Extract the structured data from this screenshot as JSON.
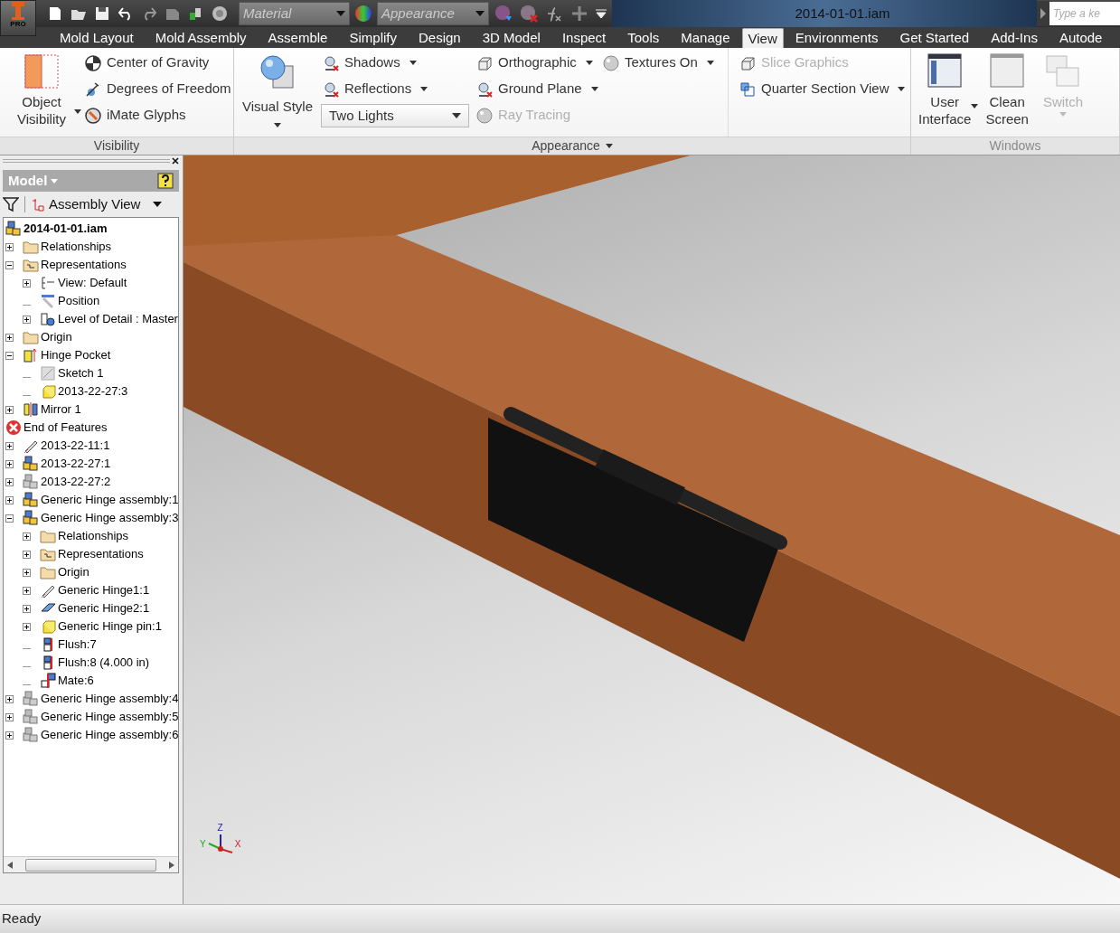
{
  "title_bar": {
    "app_badge": "PRO",
    "material": "Material",
    "appearance": "Appearance",
    "title": "2014-01-01.iam",
    "search_placeholder": "Type a ke"
  },
  "tabs": [
    {
      "label": "Mold Layout",
      "selected": false
    },
    {
      "label": "Mold Assembly",
      "selected": false
    },
    {
      "label": "Assemble",
      "selected": false
    },
    {
      "label": "Simplify",
      "selected": false
    },
    {
      "label": "Design",
      "selected": false
    },
    {
      "label": "3D Model",
      "selected": false
    },
    {
      "label": "Inspect",
      "selected": false
    },
    {
      "label": "Tools",
      "selected": false
    },
    {
      "label": "Manage",
      "selected": false
    },
    {
      "label": "View",
      "selected": true
    },
    {
      "label": "Environments",
      "selected": false
    },
    {
      "label": "Get Started",
      "selected": false
    },
    {
      "label": "Add-Ins",
      "selected": false
    },
    {
      "label": "Autode",
      "selected": false
    }
  ],
  "ribbon": {
    "visibility": {
      "label": "Visibility",
      "big": {
        "label": "Object Visibility",
        "dropdown": true
      },
      "items": [
        {
          "label": "Center of Gravity"
        },
        {
          "label": "Degrees of Freedom"
        },
        {
          "label": "iMate Glyphs"
        }
      ]
    },
    "appearance": {
      "label": "Appearance",
      "visual_style": "Visual Style",
      "columns": [
        [
          {
            "kind": "button",
            "label": "Shadows",
            "dropdown": true,
            "disabled": false
          },
          {
            "kind": "button",
            "label": "Reflections",
            "dropdown": true,
            "disabled": false
          },
          {
            "kind": "combo",
            "label": "Two Lights"
          }
        ],
        [
          {
            "kind": "button",
            "label": "Orthographic",
            "dropdown": true,
            "disabled": false
          },
          {
            "kind": "button",
            "label": "Ground Plane",
            "dropdown": true,
            "disabled": false
          },
          {
            "kind": "button",
            "label": "Ray Tracing",
            "dropdown": false,
            "disabled": true
          }
        ],
        [
          {
            "kind": "button",
            "label": "Textures On",
            "dropdown": true,
            "disabled": false
          }
        ],
        [
          {
            "kind": "button",
            "label": "Slice Graphics",
            "dropdown": false,
            "disabled": true
          },
          {
            "kind": "button",
            "label": "Quarter Section View",
            "dropdown": true,
            "disabled": false
          }
        ]
      ]
    },
    "windows": {
      "label": "Windows",
      "items": [
        {
          "label": "User Interface",
          "dropdown": true,
          "disabled": false
        },
        {
          "label": "Clean Screen",
          "dropdown": false,
          "disabled": false
        },
        {
          "label": "Switch",
          "dropdown": true,
          "disabled": true
        }
      ]
    }
  },
  "browser": {
    "title": "Model",
    "view": "Assembly View",
    "tree": {
      "label": "2014-01-01.iam",
      "kind": "assembly",
      "bold": true,
      "children": [
        {
          "label": "Relationships",
          "kind": "folder",
          "expanded": false
        },
        {
          "label": "Representations",
          "kind": "reps",
          "expanded": true,
          "children": [
            {
              "label": "View: Default",
              "kind": "view",
              "expanded": false
            },
            {
              "label": "Position",
              "kind": "position"
            },
            {
              "label": "Level of Detail : Master",
              "kind": "lod",
              "expanded": false
            }
          ]
        },
        {
          "label": "Origin",
          "kind": "folder",
          "expanded": false
        },
        {
          "label": "Hinge Pocket",
          "kind": "feature",
          "expanded": true,
          "children": [
            {
              "label": "Sketch 1",
              "kind": "sketch"
            },
            {
              "label": "2013-22-27:3",
              "kind": "part"
            }
          ]
        },
        {
          "label": "Mirror 1",
          "kind": "mirror",
          "expanded": false
        },
        {
          "label": "End of Features",
          "kind": "end"
        },
        {
          "label": "2013-22-11:1",
          "kind": "pin",
          "expanded": false
        },
        {
          "label": "2013-22-27:1",
          "kind": "assembly",
          "expanded": false
        },
        {
          "label": "2013-22-27:2",
          "kind": "assembly-grey",
          "expanded": false
        },
        {
          "label": "Generic Hinge assembly:1",
          "kind": "assembly",
          "expanded": false
        },
        {
          "label": "Generic Hinge assembly:3",
          "kind": "assembly",
          "expanded": true,
          "children": [
            {
              "label": "Relationships",
              "kind": "folder",
              "expanded": false
            },
            {
              "label": "Representations",
              "kind": "reps",
              "expanded": false
            },
            {
              "label": "Origin",
              "kind": "folder",
              "expanded": false
            },
            {
              "label": "Generic Hinge1:1",
              "kind": "pin",
              "expanded": false
            },
            {
              "label": "Generic Hinge2:1",
              "kind": "leaf",
              "expanded": false
            },
            {
              "label": "Generic Hinge pin:1",
              "kind": "part",
              "expanded": false
            },
            {
              "label": "Flush:7",
              "kind": "flush"
            },
            {
              "label": "Flush:8 (4.000 in)",
              "kind": "flush"
            },
            {
              "label": "Mate:6",
              "kind": "mate"
            }
          ]
        },
        {
          "label": "Generic Hinge assembly:4",
          "kind": "assembly-grey",
          "expanded": false
        },
        {
          "label": "Generic Hinge assembly:5",
          "kind": "assembly-grey",
          "expanded": false
        },
        {
          "label": "Generic Hinge assembly:6",
          "kind": "assembly-grey",
          "expanded": false
        }
      ]
    }
  },
  "viewport": {
    "axes": {
      "x": "X",
      "y": "Y",
      "z": "Z"
    }
  },
  "status_bar": "Ready"
}
